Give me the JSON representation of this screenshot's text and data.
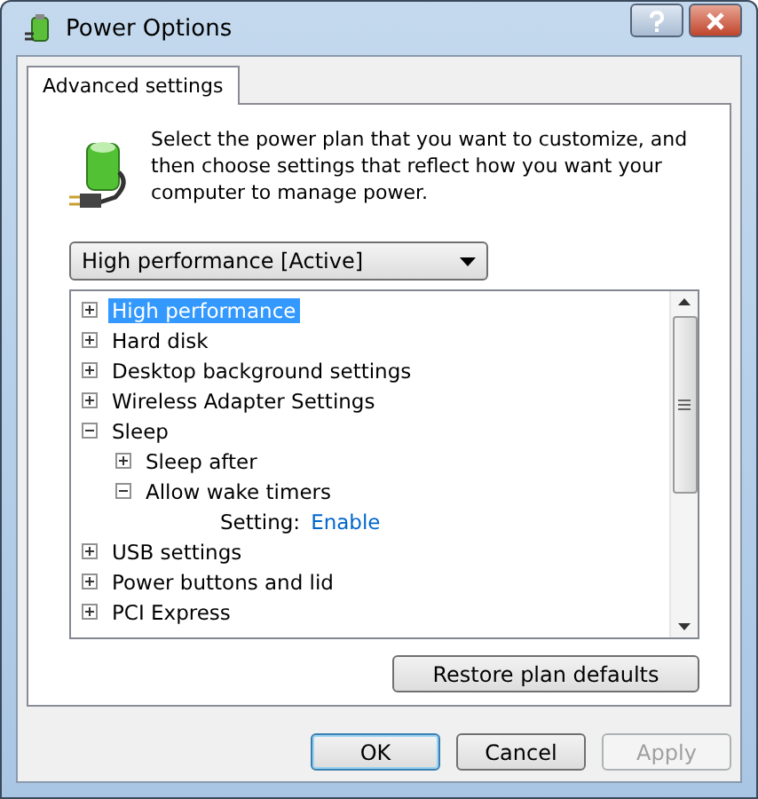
{
  "window": {
    "title": "Power Options"
  },
  "tabs": [
    {
      "label": "Advanced settings",
      "selected": true
    }
  ],
  "description": "Select the power plan that you want to customize, and then choose settings that reflect how you want your computer to manage power.",
  "plan_dropdown": {
    "value": "High performance [Active]"
  },
  "tree": [
    {
      "kind": "node",
      "label": "High performance",
      "expanded": false,
      "selected": true
    },
    {
      "kind": "node",
      "label": "Hard disk",
      "expanded": false,
      "selected": false
    },
    {
      "kind": "node",
      "label": "Desktop background settings",
      "expanded": false,
      "selected": false
    },
    {
      "kind": "node",
      "label": "Wireless Adapter Settings",
      "expanded": false,
      "selected": false
    },
    {
      "kind": "node",
      "label": "Sleep",
      "expanded": true,
      "selected": false,
      "children": [
        {
          "kind": "node",
          "label": "Sleep after",
          "expanded": false,
          "selected": false
        },
        {
          "kind": "node",
          "label": "Allow wake timers",
          "expanded": true,
          "selected": false,
          "children": [
            {
              "kind": "setting",
              "label": "Setting:",
              "value": "Enable",
              "selected": false
            }
          ]
        }
      ]
    },
    {
      "kind": "node",
      "label": "USB settings",
      "expanded": false,
      "selected": false
    },
    {
      "kind": "node",
      "label": "Power buttons and lid",
      "expanded": false,
      "selected": false
    },
    {
      "kind": "node",
      "label": "PCI Express",
      "expanded": false,
      "selected": false
    }
  ],
  "restore_button": "Restore plan defaults",
  "buttons": [
    {
      "label": "OK",
      "kind": "default",
      "disabled": false
    },
    {
      "label": "Cancel",
      "kind": "normal",
      "disabled": false
    },
    {
      "label": "Apply",
      "kind": "normal",
      "disabled": true
    }
  ]
}
